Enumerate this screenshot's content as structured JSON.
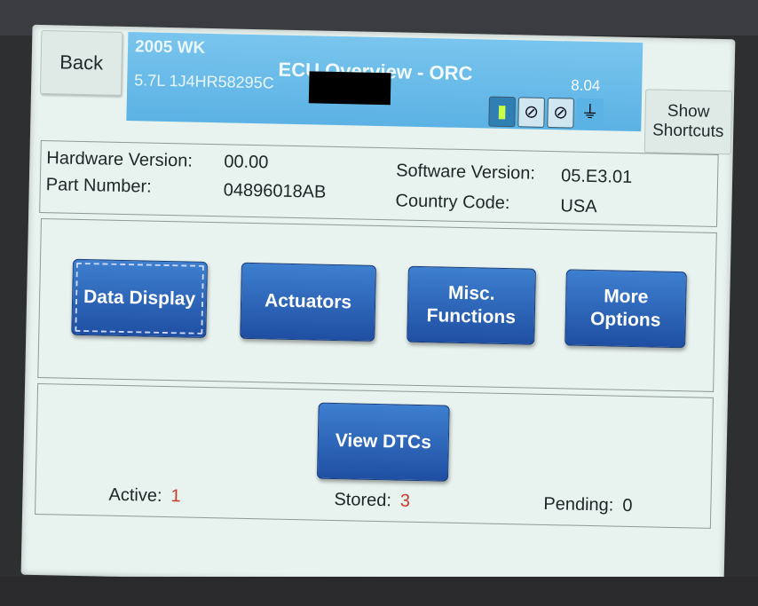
{
  "nav": {
    "back_label": "Back"
  },
  "header": {
    "vehicle_line1": "2005 WK",
    "vehicle_line2": "5.7L 1J4HR58295C",
    "title": "ECU Overview - ORC",
    "version": "8.04"
  },
  "status_icons": [
    "battery-icon",
    "no-connection-icon",
    "no-link-icon",
    "plug-icon"
  ],
  "shortcuts": {
    "label_line1": "Show",
    "label_line2": "Shortcuts"
  },
  "info": {
    "hardware_label": "Hardware Version:",
    "hardware_value": "00.00",
    "part_label": "Part Number:",
    "part_value": "04896018AB",
    "software_label": "Software Version:",
    "software_value": "05.E3.01",
    "country_label": "Country Code:",
    "country_value": "USA"
  },
  "buttons": {
    "data_display": "Data Display",
    "actuators": "Actuators",
    "misc_line1": "Misc.",
    "misc_line2": "Functions",
    "more_line1": "More",
    "more_line2": "Options",
    "view_dtcs": "View DTCs"
  },
  "dtc_counts": {
    "active_label": "Active:",
    "active_value": "1",
    "stored_label": "Stored:",
    "stored_value": "3",
    "pending_label": "Pending:",
    "pending_value": "0"
  },
  "colors": {
    "header_blue": "#5bb2e4",
    "button_blue": "#1f4fa3",
    "count_red": "#c63b2c"
  }
}
